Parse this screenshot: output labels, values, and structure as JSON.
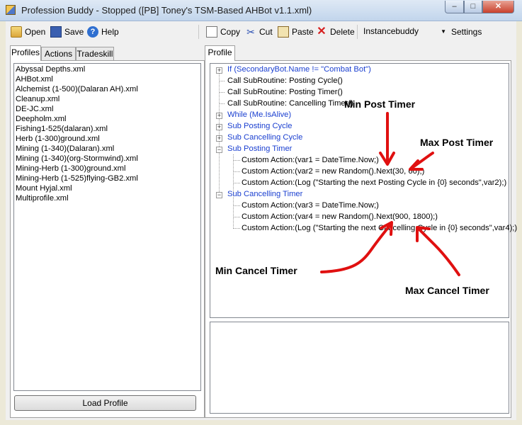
{
  "window": {
    "title": "Profession Buddy - Stopped ([PB] Toney's TSM-Based AHBot v1.1.xml)",
    "controls": {
      "minimize": "–",
      "maximize": "□",
      "close": "✕"
    }
  },
  "toolbar": {
    "open_label": "Open",
    "save_label": "Save",
    "help_label": "Help",
    "copy_label": "Copy",
    "cut_label": "Cut",
    "paste_label": "Paste",
    "delete_label": "Delete",
    "bot_select_value": "Instancebuddy",
    "settings_label": "Settings"
  },
  "left_tabs": [
    "Profiles",
    "Actions",
    "Tradeskill"
  ],
  "profiles": [
    "Abyssal Depths.xml",
    "AHBot.xml",
    "Alchemist (1-500)(Dalaran AH).xml",
    "Cleanup.xml",
    "DE-JC.xml",
    "Deepholm.xml",
    "Fishing1-525(dalaran).xml",
    "Herb (1-300)ground.xml",
    "Mining (1-340)(Dalaran).xml",
    "Mining (1-340)(org-Stormwind).xml",
    "Mining-Herb (1-300)ground.xml",
    "Mining-Herb (1-525)flying-GB2.xml",
    "Mount Hyjal.xml",
    "Multiprofile.xml"
  ],
  "load_profile_label": "Load Profile",
  "right_tab": "Profile",
  "tree": {
    "if_node": "If (SecondaryBot.Name != \"Combat Bot\")",
    "call_posting_cycle": "Call SubRoutine: Posting Cycle()",
    "call_posting_timer": "Call SubRoutine: Posting Timer()",
    "call_cancelling_timer": "Call SubRoutine: Cancelling Timer()",
    "while_node": "While (Me.IsAlive)",
    "sub_posting_cycle": "Sub Posting Cycle",
    "sub_cancelling_cycle": "Sub Cancelling Cycle",
    "sub_posting_timer": "Sub Posting Timer",
    "pt_action_1": "Custom Action:(var1 = DateTime.Now;)",
    "pt_action_2": "Custom Action:(var2 = new Random().Next(30, 60);)",
    "pt_action_3": "Custom Action:(Log (\"Starting the next Posting Cycle in {0} seconds\",var2);)",
    "sub_cancelling_timer": "Sub Cancelling Timer",
    "ct_action_1": "Custom Action:(var3 = DateTime.Now;)",
    "ct_action_2": "Custom Action:(var4 = new Random().Next(900, 1800);)",
    "ct_action_3": "Custom Action:(Log (\"Starting the next Cancelling Cycle in {0} seconds\",var4);)"
  },
  "annotations": {
    "min_post": "Min Post Timer",
    "max_post": "Max Post Timer",
    "min_cancel": "Min Cancel Timer",
    "max_cancel": "Max Cancel Timer"
  },
  "colors": {
    "link_blue": "#1a3fd0",
    "arrow_red": "#e01010"
  }
}
